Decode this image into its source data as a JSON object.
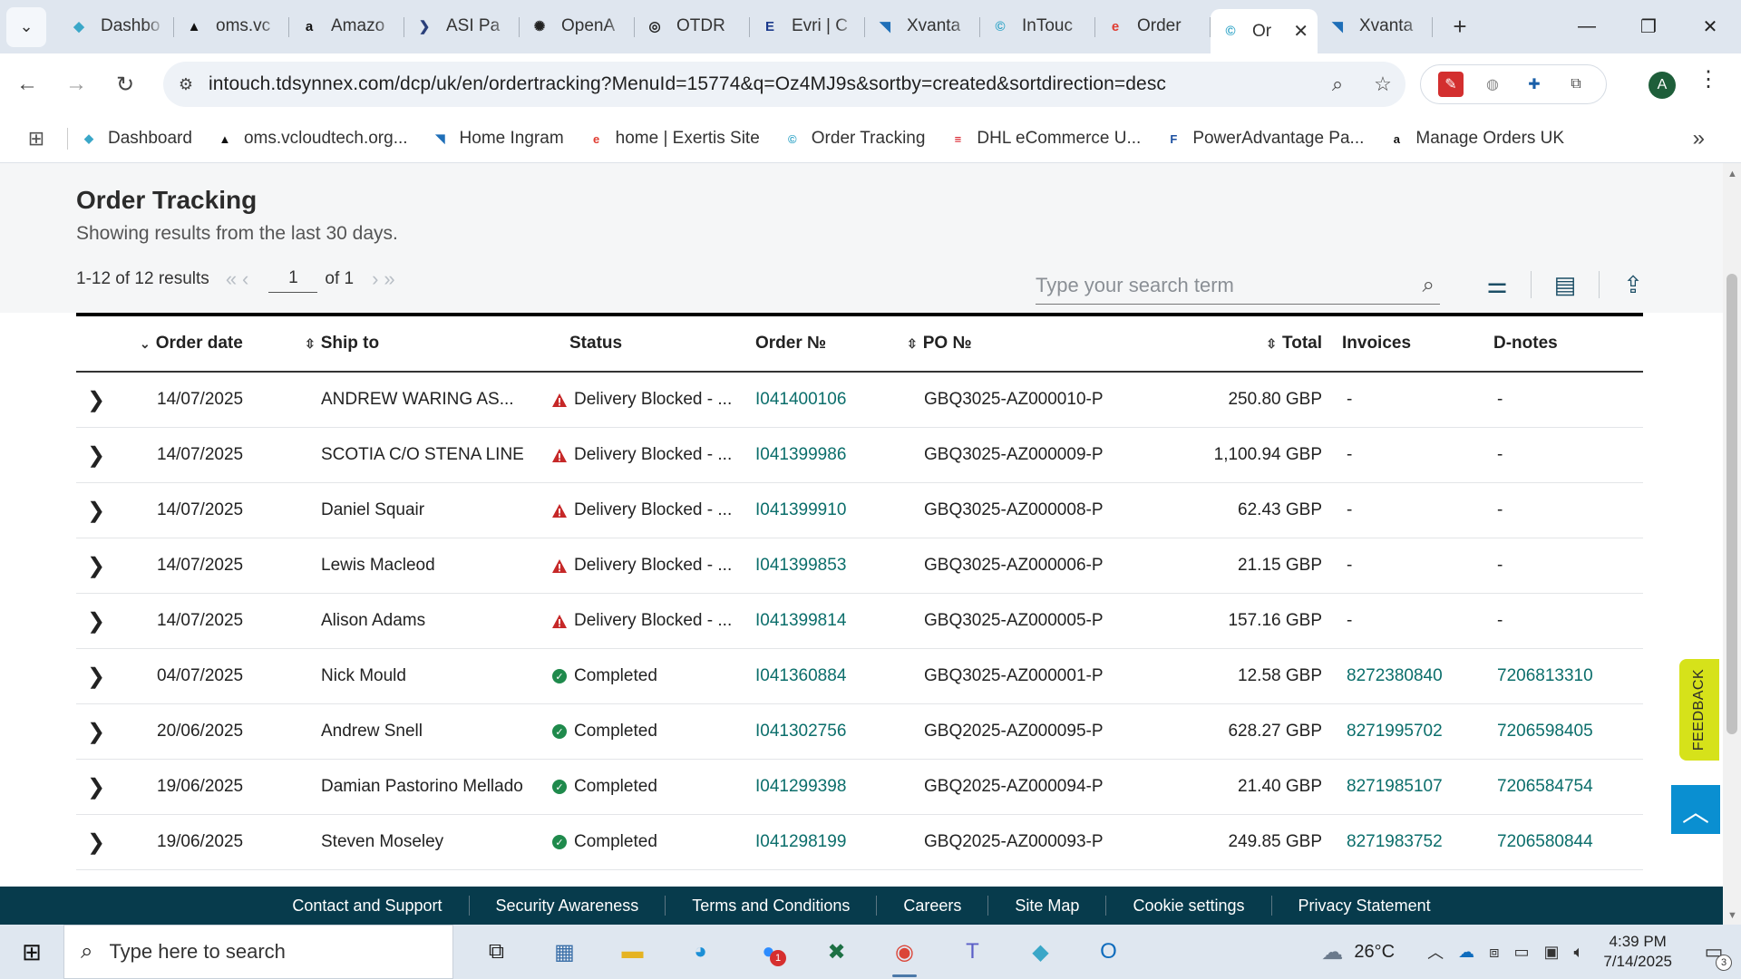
{
  "browser": {
    "tabs": [
      {
        "label": "Dashbo",
        "icon": "dashboard-favicon",
        "color": "#3aa7c8",
        "glyph": "◆"
      },
      {
        "label": "oms.vc",
        "icon": "oms-favicon",
        "color": "#111111",
        "glyph": "▲"
      },
      {
        "label": "Amazo",
        "icon": "amazon-favicon",
        "color": "#111111",
        "glyph": "a"
      },
      {
        "label": "ASI Pa",
        "icon": "asi-favicon",
        "color": "#2a3f7a",
        "glyph": "❯"
      },
      {
        "label": "OpenA",
        "icon": "openai-favicon",
        "color": "#222222",
        "glyph": "✺"
      },
      {
        "label": "OTDR",
        "icon": "otdr-favicon",
        "color": "#222222",
        "glyph": "◎"
      },
      {
        "label": "Evri | C",
        "icon": "evri-favicon",
        "color": "#1b3a8c",
        "glyph": "E"
      },
      {
        "label": "Xvanta",
        "icon": "xvantage-favicon",
        "color": "#1f6fb8",
        "glyph": "◥"
      },
      {
        "label": "InTouc",
        "icon": "intouch-favicon",
        "color": "#2fa4c7",
        "glyph": "©"
      },
      {
        "label": "Order",
        "icon": "exertis-favicon",
        "color": "#e03c31",
        "glyph": "e"
      },
      {
        "label": "Or",
        "icon": "intouch-favicon",
        "color": "#2fa4c7",
        "glyph": "©",
        "active": true
      },
      {
        "label": "Xvanta",
        "icon": "xvantage-favicon",
        "color": "#1f6fb8",
        "glyph": "◥"
      }
    ],
    "url": "intouch.tdsynnex.com/dcp/uk/en/ordertracking?MenuId=15774&q=Oz4MJ9s&sortby=created&sortdirection=desc",
    "profile_initial": "A",
    "bookmarks": [
      {
        "label": "Dashboard",
        "icon": "dashboard-favicon",
        "color": "#3aa7c8",
        "glyph": "◆"
      },
      {
        "label": "oms.vcloudtech.org...",
        "icon": "oms-favicon",
        "color": "#111111",
        "glyph": "▲"
      },
      {
        "label": "Home Ingram",
        "icon": "ingram-favicon",
        "color": "#1f6fb8",
        "glyph": "◥"
      },
      {
        "label": "home | Exertis Site",
        "icon": "exertis-favicon",
        "color": "#e03c31",
        "glyph": "e"
      },
      {
        "label": "Order Tracking",
        "icon": "intouch-favicon",
        "color": "#2fa4c7",
        "glyph": "©"
      },
      {
        "label": "DHL eCommerce U...",
        "icon": "dhl-favicon",
        "color": "#d40511",
        "glyph": "≡"
      },
      {
        "label": "PowerAdvantage Pa...",
        "icon": "poweradvantage-favicon",
        "color": "#1b4fa0",
        "glyph": "F"
      },
      {
        "label": "Manage Orders UK",
        "icon": "amazon-favicon",
        "color": "#111111",
        "glyph": "a"
      }
    ]
  },
  "page": {
    "title": "Order Tracking",
    "subtitle": "Showing results from the last 30 days.",
    "results_label": "1-12 of 12 results",
    "page_value": "1",
    "page_of": "of 1",
    "search_placeholder": "Type your search term"
  },
  "table": {
    "headers": {
      "order_date": "Order date",
      "ship_to": "Ship to",
      "status": "Status",
      "order_no": "Order №",
      "po_no": "PO №",
      "total": "Total",
      "invoices": "Invoices",
      "dnotes": "D-notes"
    },
    "rows": [
      {
        "date": "14/07/2025",
        "ship_to": "ANDREW WARING AS...",
        "status": "Delivery Blocked - ...",
        "status_type": "blocked",
        "order_no": "I041400106",
        "po_no": "GBQ3025-AZ000010-P",
        "total": "250.80 GBP",
        "invoice": "-",
        "dnote": "-"
      },
      {
        "date": "14/07/2025",
        "ship_to": "SCOTIA C/O STENA LINE",
        "status": "Delivery Blocked - ...",
        "status_type": "blocked",
        "order_no": "I041399986",
        "po_no": "GBQ3025-AZ000009-P",
        "total": "1,100.94 GBP",
        "invoice": "-",
        "dnote": "-"
      },
      {
        "date": "14/07/2025",
        "ship_to": "Daniel Squair",
        "status": "Delivery Blocked - ...",
        "status_type": "blocked",
        "order_no": "I041399910",
        "po_no": "GBQ3025-AZ000008-P",
        "total": "62.43 GBP",
        "invoice": "-",
        "dnote": "-"
      },
      {
        "date": "14/07/2025",
        "ship_to": "Lewis Macleod",
        "status": "Delivery Blocked - ...",
        "status_type": "blocked",
        "order_no": "I041399853",
        "po_no": "GBQ3025-AZ000006-P",
        "total": "21.15 GBP",
        "invoice": "-",
        "dnote": "-"
      },
      {
        "date": "14/07/2025",
        "ship_to": "Alison Adams",
        "status": "Delivery Blocked - ...",
        "status_type": "blocked",
        "order_no": "I041399814",
        "po_no": "GBQ3025-AZ000005-P",
        "total": "157.16 GBP",
        "invoice": "-",
        "dnote": "-"
      },
      {
        "date": "04/07/2025",
        "ship_to": "Nick Mould",
        "status": "Completed",
        "status_type": "completed",
        "order_no": "I041360884",
        "po_no": "GBQ3025-AZ000001-P",
        "total": "12.58 GBP",
        "invoice": "8272380840",
        "dnote": "7206813310"
      },
      {
        "date": "20/06/2025",
        "ship_to": "Andrew Snell",
        "status": "Completed",
        "status_type": "completed",
        "order_no": "I041302756",
        "po_no": "GBQ2025-AZ000095-P",
        "total": "628.27 GBP",
        "invoice": "8271995702",
        "dnote": "7206598405"
      },
      {
        "date": "19/06/2025",
        "ship_to": "Damian Pastorino Mellado",
        "status": "Completed",
        "status_type": "completed",
        "order_no": "I041299398",
        "po_no": "GBQ2025-AZ000094-P",
        "total": "21.40 GBP",
        "invoice": "8271985107",
        "dnote": "7206584754"
      },
      {
        "date": "19/06/2025",
        "ship_to": "Steven Moseley",
        "status": "Completed",
        "status_type": "completed",
        "order_no": "I041298199",
        "po_no": "GBQ2025-AZ000093-P",
        "total": "249.85 GBP",
        "invoice": "8271983752",
        "dnote": "7206580844"
      }
    ]
  },
  "feedback_label": "FEEDBACK",
  "footer": {
    "links": [
      "Contact and Support",
      "Security Awareness",
      "Terms and Conditions",
      "Careers",
      "Site Map",
      "Cookie settings",
      "Privacy Statement"
    ]
  },
  "taskbar": {
    "search_placeholder": "Type here to search",
    "weather": "26°C",
    "weather_badge": "1",
    "time": "4:39 PM",
    "date": "7/14/2025",
    "notification_count": "3",
    "zoom_badge": "1"
  },
  "colors": {
    "link": "#0b6e6b",
    "blocked": "#c62828",
    "completed": "#1f8a4c",
    "footer": "#073b4c",
    "feedback": "#d6e21a",
    "to_top": "#0a8fd1"
  }
}
